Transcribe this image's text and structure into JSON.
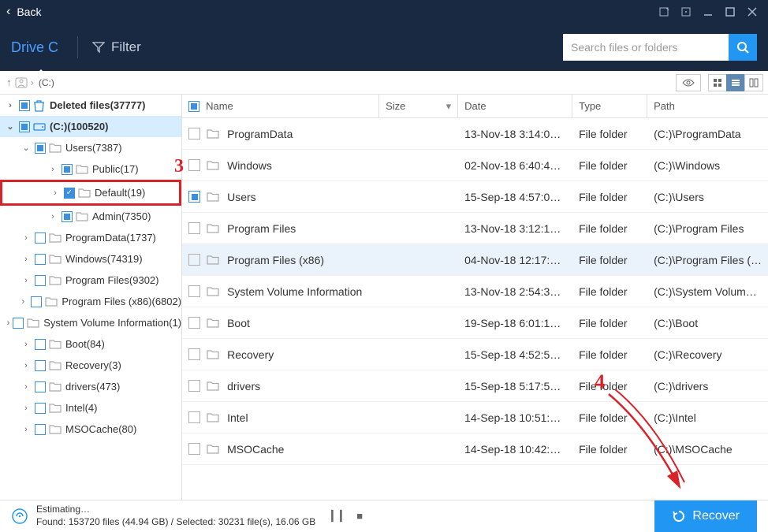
{
  "titlebar": {
    "back": "Back"
  },
  "toolbar": {
    "drive": "Drive C",
    "filter": "Filter",
    "search_placeholder": "Search files or folders"
  },
  "breadcrumb": {
    "label": "(C:)"
  },
  "columns": {
    "name": "Name",
    "size": "Size",
    "date": "Date",
    "type": "Type",
    "path": "Path"
  },
  "tree": [
    {
      "indent": 0,
      "toggle": "›",
      "check": "partial",
      "icon": "trash",
      "label": "Deleted files(37777)",
      "bold": true
    },
    {
      "indent": 0,
      "toggle": "v",
      "check": "partial",
      "icon": "disk",
      "label": "(C:)(100520)",
      "bold": true,
      "active": true
    },
    {
      "indent": 1,
      "toggle": "v",
      "check": "partial",
      "icon": "folder",
      "label": "Users(7387)"
    },
    {
      "indent": 2,
      "toggle": "›",
      "check": "partial",
      "icon": "folder",
      "label": "Public(17)"
    },
    {
      "indent": 2,
      "toggle": "›",
      "check": "full",
      "icon": "folder",
      "label": "Default(19)",
      "highlight": true
    },
    {
      "indent": 2,
      "toggle": "›",
      "check": "partial",
      "icon": "folder",
      "label": "Admin(7350)"
    },
    {
      "indent": 1,
      "toggle": "›",
      "check": "none",
      "icon": "folder",
      "label": "ProgramData(1737)"
    },
    {
      "indent": 1,
      "toggle": "›",
      "check": "none",
      "icon": "folder",
      "label": "Windows(74319)"
    },
    {
      "indent": 1,
      "toggle": "›",
      "check": "none",
      "icon": "folder",
      "label": "Program Files(9302)"
    },
    {
      "indent": 1,
      "toggle": "›",
      "check": "none",
      "icon": "folder",
      "label": "Program Files (x86)(6802)"
    },
    {
      "indent": 1,
      "toggle": "›",
      "check": "none",
      "icon": "folder",
      "label": "System Volume Information(1)"
    },
    {
      "indent": 1,
      "toggle": "›",
      "check": "none",
      "icon": "folder",
      "label": "Boot(84)"
    },
    {
      "indent": 1,
      "toggle": "›",
      "check": "none",
      "icon": "folder",
      "label": "Recovery(3)"
    },
    {
      "indent": 1,
      "toggle": "›",
      "check": "none",
      "icon": "folder",
      "label": "drivers(473)"
    },
    {
      "indent": 1,
      "toggle": "›",
      "check": "none",
      "icon": "folder",
      "label": "Intel(4)"
    },
    {
      "indent": 1,
      "toggle": "›",
      "check": "none",
      "icon": "folder",
      "label": "MSOCache(80)"
    }
  ],
  "rows": [
    {
      "check": "none",
      "name": "ProgramData",
      "size": "",
      "date": "13-Nov-18 3:14:00 …",
      "type": "File folder",
      "path": "(C:)\\ProgramData"
    },
    {
      "check": "none",
      "name": "Windows",
      "size": "",
      "date": "02-Nov-18 6:40:47 …",
      "type": "File folder",
      "path": "(C:)\\Windows"
    },
    {
      "check": "partial",
      "name": "Users",
      "size": "",
      "date": "15-Sep-18 4:57:06 …",
      "type": "File folder",
      "path": "(C:)\\Users"
    },
    {
      "check": "none",
      "name": "Program Files",
      "size": "",
      "date": "13-Nov-18 3:12:17 …",
      "type": "File folder",
      "path": "(C:)\\Program Files"
    },
    {
      "check": "none",
      "name": "Program Files (x86)",
      "size": "",
      "date": "04-Nov-18 12:17:48…",
      "type": "File folder",
      "path": "(C:)\\Program Files (…",
      "sel": true
    },
    {
      "check": "none",
      "name": "System Volume Information",
      "size": "",
      "date": "13-Nov-18 2:54:31 …",
      "type": "File folder",
      "path": "(C:)\\System Volum…"
    },
    {
      "check": "none",
      "name": "Boot",
      "size": "",
      "date": "19-Sep-18 6:01:17 …",
      "type": "File folder",
      "path": "(C:)\\Boot"
    },
    {
      "check": "none",
      "name": "Recovery",
      "size": "",
      "date": "15-Sep-18 4:52:58 …",
      "type": "File folder",
      "path": "(C:)\\Recovery"
    },
    {
      "check": "none",
      "name": "drivers",
      "size": "",
      "date": "15-Sep-18 5:17:54 …",
      "type": "File folder",
      "path": "(C:)\\drivers"
    },
    {
      "check": "none",
      "name": "Intel",
      "size": "",
      "date": "14-Sep-18 10:51:29…",
      "type": "File folder",
      "path": "(C:)\\Intel"
    },
    {
      "check": "none",
      "name": "MSOCache",
      "size": "",
      "date": "14-Sep-18 10:42:25…",
      "type": "File folder",
      "path": "(C:)\\MSOCache"
    }
  ],
  "footer": {
    "line1": "Estimating…",
    "line2": "Found: 153720 files (44.94 GB) / Selected: 30231 file(s), 16.06 GB",
    "recover": "Recover"
  },
  "annot": {
    "n3": "3",
    "n4": "4"
  }
}
